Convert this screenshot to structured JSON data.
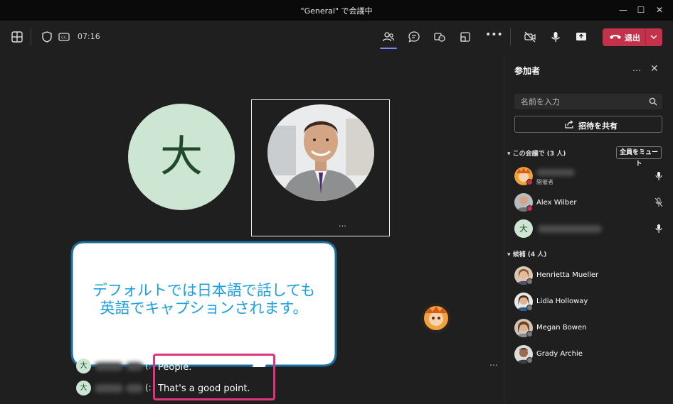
{
  "window": {
    "title": "\"General\" で会議中"
  },
  "toolbar": {
    "time": "07:16",
    "leave_label": "退出"
  },
  "stage": {
    "avatar_initial": "大",
    "tile_more": "…",
    "callout_line1": "デフォルトでは日本語で話しても",
    "callout_line2": "英語でキャプションされます。",
    "captions": [
      {
        "initial": "大",
        "punct": "(:",
        "text": "People."
      },
      {
        "initial": "大",
        "punct": "(:",
        "text": "That's a good point."
      }
    ],
    "captions_more": "…"
  },
  "panel": {
    "title": "参加者",
    "more": "…",
    "search_placeholder": "名前を入力",
    "invite_label": "招待を共有",
    "in_meeting_label": "この会議で (3 人)",
    "mute_all_label": "全員をミュート",
    "in_meeting": [
      {
        "name": "",
        "sub": "開催者",
        "mic": "on"
      },
      {
        "name": "Alex Wilber",
        "sub": "",
        "mic": "muted"
      },
      {
        "name": "",
        "sub": "",
        "initial": "大",
        "mic": "on"
      }
    ],
    "suggested_label": "候補 (4 人)",
    "suggested": [
      {
        "name": "Henrietta Mueller"
      },
      {
        "name": "Lidia Holloway"
      },
      {
        "name": "Megan Bowen"
      },
      {
        "name": "Grady Archie"
      }
    ]
  },
  "colors": {
    "leave": "#c4314b",
    "accent": "#7f85f5",
    "callout_text": "#1aa0e0",
    "highlight": "#e0357c"
  }
}
